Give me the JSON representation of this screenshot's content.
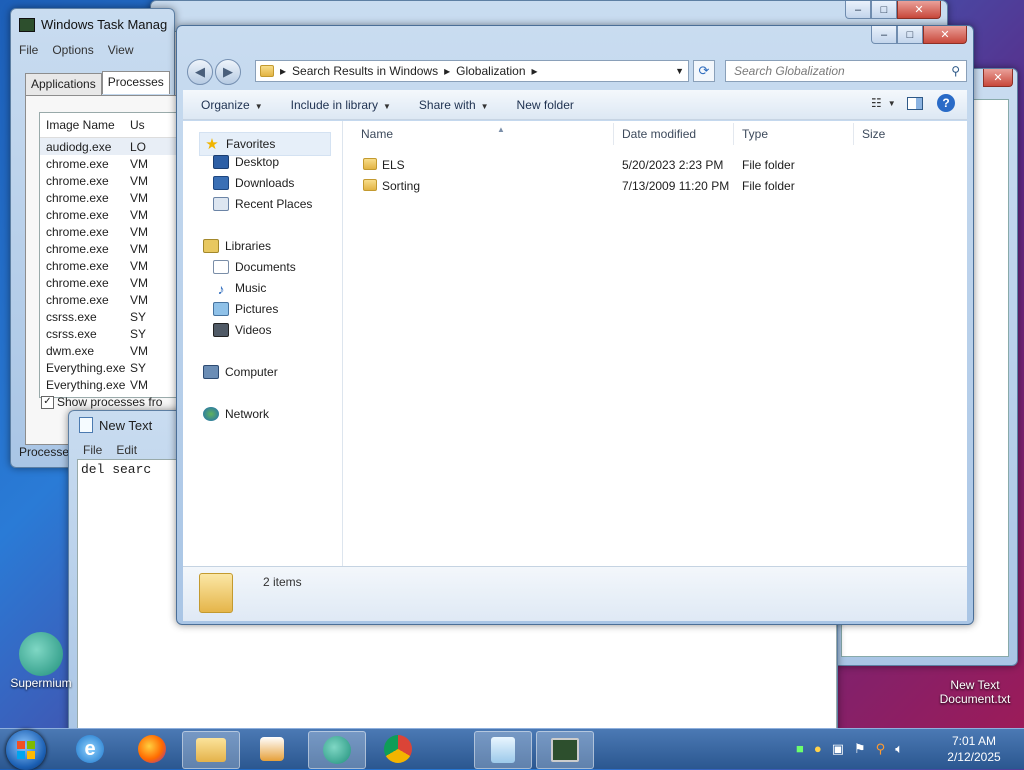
{
  "taskmgr": {
    "title": "Windows Task Manag",
    "menu": [
      "File",
      "Options",
      "View"
    ],
    "tabs": [
      "Applications",
      "Processes"
    ],
    "columns": [
      "Image Name",
      "Us"
    ],
    "rows": [
      {
        "name": "audiodg.exe",
        "user": "LO"
      },
      {
        "name": "chrome.exe",
        "user": "VM"
      },
      {
        "name": "chrome.exe",
        "user": "VM"
      },
      {
        "name": "chrome.exe",
        "user": "VM"
      },
      {
        "name": "chrome.exe",
        "user": "VM"
      },
      {
        "name": "chrome.exe",
        "user": "VM"
      },
      {
        "name": "chrome.exe",
        "user": "VM"
      },
      {
        "name": "chrome.exe",
        "user": "VM"
      },
      {
        "name": "chrome.exe",
        "user": "VM"
      },
      {
        "name": "chrome.exe",
        "user": "VM"
      },
      {
        "name": "csrss.exe",
        "user": "SY"
      },
      {
        "name": "csrss.exe",
        "user": "SY"
      },
      {
        "name": "dwm.exe",
        "user": "VM"
      },
      {
        "name": "Everything.exe",
        "user": "SY"
      },
      {
        "name": "Everything.exe",
        "user": "VM"
      }
    ],
    "show_processes": "Show processes fro",
    "status": "Processes"
  },
  "notepad": {
    "title": "New Text",
    "menu": [
      "File",
      "Edit"
    ],
    "content": "del searc"
  },
  "explorer": {
    "address": [
      "Search Results in Windows",
      "Globalization"
    ],
    "search_placeholder": "Search Globalization",
    "toolbar": {
      "organize": "Organize",
      "include": "Include in library",
      "share": "Share with",
      "new_folder": "New folder"
    },
    "nav": {
      "favorites": "Favorites",
      "desktop": "Desktop",
      "downloads": "Downloads",
      "recent": "Recent Places",
      "libraries": "Libraries",
      "documents": "Documents",
      "music": "Music",
      "pictures": "Pictures",
      "videos": "Videos",
      "computer": "Computer",
      "network": "Network"
    },
    "columns": {
      "name": "Name",
      "date": "Date modified",
      "type": "Type",
      "size": "Size"
    },
    "files": [
      {
        "name": "ELS",
        "date": "5/20/2023 2:23 PM",
        "type": "File folder"
      },
      {
        "name": "Sorting",
        "date": "7/13/2009 11:20 PM",
        "type": "File folder"
      }
    ],
    "item_count": "2 items"
  },
  "desktop": {
    "supermium": "Supermium",
    "newtext_line1": "New Text",
    "newtext_line2": "Document.txt"
  },
  "taskbar": {
    "time": "7:01 AM",
    "date": "2/12/2025"
  }
}
